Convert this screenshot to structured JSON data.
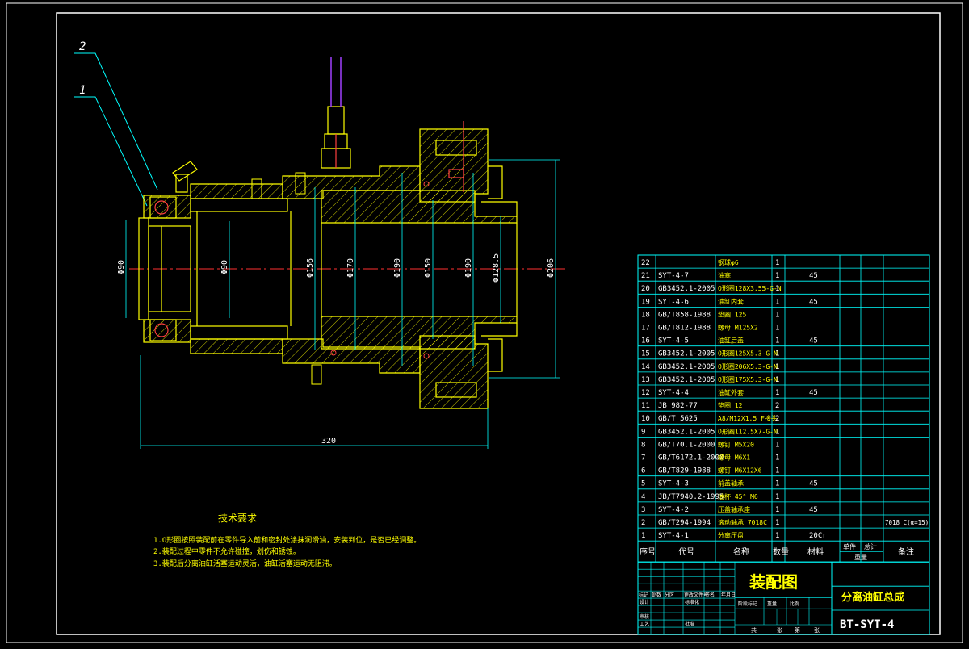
{
  "colors": {
    "background": "#000000",
    "frame": "#ffffff",
    "table_lines": "#00ffff",
    "table_text": "#ffffff",
    "section": "#ffff00",
    "hatch": "#ffff00",
    "centerline": "#ff3030",
    "dimension": "#00ffff",
    "leader": "#00ffff",
    "notes": "#ffff00",
    "rod": "#a040ff",
    "part_text_cjk": "#ffff00",
    "qty_text": "#ffffff",
    "title_drawing": "#ffff00",
    "title_code": "#ffffff"
  },
  "balloons": [
    "2",
    "1"
  ],
  "dimensions": {
    "length_320": "320",
    "d90_left": "Φ90",
    "d90_right": "Φ90",
    "d156": "Φ156",
    "d170": "Φ170",
    "d190a": "Φ190",
    "d150": "Φ150",
    "d190b": "Φ190",
    "d128_5": "Φ128.5",
    "d206": "Φ206"
  },
  "notes": {
    "title": "技术要求",
    "items": [
      "1.O形圈按照装配前在零件导入前和密封处涂抹润滑油，安装到位，是否已经调整。",
      "2.装配过程中零件不允许碰撞，划伤和锈蚀。",
      "3.装配后分离油缸活塞运动灵活，油缸活塞运动无阻滞。"
    ]
  },
  "bom": {
    "rows": [
      {
        "no": "22",
        "code": "",
        "name": "钢球φ6",
        "qty": "1",
        "material": "",
        "weight1": "",
        "note": ""
      },
      {
        "no": "21",
        "code": "SYT-4-7",
        "name": "油塞",
        "qty": "1",
        "material": "45",
        "weight1": "",
        "note": ""
      },
      {
        "no": "20",
        "code": "GB3452.1-2005",
        "name": "O形圈128X3.55-G-N",
        "qty": "1",
        "material": "",
        "weight1": "",
        "note": ""
      },
      {
        "no": "19",
        "code": "SYT-4-6",
        "name": "油缸内套",
        "qty": "1",
        "material": "45",
        "weight1": "",
        "note": ""
      },
      {
        "no": "18",
        "code": "GB/T858-1988",
        "name": "垫圈 125",
        "qty": "1",
        "material": "",
        "weight1": "",
        "note": ""
      },
      {
        "no": "17",
        "code": "GB/T812-1988",
        "name": "螺母 M125X2",
        "qty": "1",
        "material": "",
        "weight1": "",
        "note": ""
      },
      {
        "no": "16",
        "code": "SYT-4-5",
        "name": "油缸后盖",
        "qty": "1",
        "material": "45",
        "weight1": "",
        "note": ""
      },
      {
        "no": "15",
        "code": "GB3452.1-2005",
        "name": "O形圈125X5.3-G-N",
        "qty": "1",
        "material": "",
        "weight1": "",
        "note": ""
      },
      {
        "no": "14",
        "code": "GB3452.1-2005",
        "name": "O形圈206X5.3-G-N",
        "qty": "1",
        "material": "",
        "weight1": "",
        "note": ""
      },
      {
        "no": "13",
        "code": "GB3452.1-2005",
        "name": "O形圈175X5.3-G-N",
        "qty": "1",
        "material": "",
        "weight1": "",
        "note": ""
      },
      {
        "no": "12",
        "code": "SYT-4-4",
        "name": "油缸外套",
        "qty": "1",
        "material": "45",
        "weight1": "",
        "note": ""
      },
      {
        "no": "11",
        "code": "JB 982-77",
        "name": "垫圈 12",
        "qty": "2",
        "material": "",
        "weight1": "",
        "note": ""
      },
      {
        "no": "10",
        "code": "GB/T 5625",
        "name": "A8/M12X1.5 F接头",
        "qty": "2",
        "material": "",
        "weight1": "",
        "note": ""
      },
      {
        "no": "9",
        "code": "GB3452.1-2005",
        "name": "O形圈112.5X7-G-N",
        "qty": "1",
        "material": "",
        "weight1": "",
        "note": ""
      },
      {
        "no": "8",
        "code": "GB/T70.1-2000",
        "name": "螺钉 M5X20",
        "qty": "1",
        "material": "",
        "weight1": "",
        "note": ""
      },
      {
        "no": "7",
        "code": "GB/T6172.1-2000",
        "name": "螺母 M6X1",
        "qty": "1",
        "material": "",
        "weight1": "",
        "note": ""
      },
      {
        "no": "6",
        "code": "GB/T829-1988",
        "name": "螺钉 M6X12X6",
        "qty": "1",
        "material": "",
        "weight1": "",
        "note": ""
      },
      {
        "no": "5",
        "code": "SYT-4-3",
        "name": "前盖轴承",
        "qty": "1",
        "material": "45",
        "weight1": "",
        "note": ""
      },
      {
        "no": "4",
        "code": "JB/T7940.2-1995",
        "name": "油杯 45° M6",
        "qty": "1",
        "material": "",
        "weight1": "",
        "note": ""
      },
      {
        "no": "3",
        "code": "SYT-4-2",
        "name": "压盖轴承座",
        "qty": "1",
        "material": "45",
        "weight1": "",
        "note": ""
      },
      {
        "no": "2",
        "code": "GB/T294-1994",
        "name": "滚动轴承 7018C",
        "qty": "1",
        "material": "",
        "weight1": "",
        "note": "7018 C(α=15)"
      },
      {
        "no": "1",
        "code": "SYT-4-1",
        "name": "分离压盘",
        "qty": "1",
        "material": "20Cr",
        "weight1": "",
        "note": ""
      }
    ],
    "headers": {
      "no": "序号",
      "code": "代号",
      "name": "名称",
      "qty": "数量",
      "material": "材料",
      "single": "单件",
      "total": "总计",
      "weight": "重量",
      "note": "备注"
    }
  },
  "title_block": {
    "drawing_type": "装配图",
    "drawing_name": "分离油缸总成",
    "drawing_code": "BT-SYT-4",
    "labels_small": [
      "标记",
      "处数",
      "分区",
      "更改文件号",
      "签名",
      "年月日"
    ],
    "labels_row2": [
      "设计",
      "标准化"
    ],
    "labels_row3": [
      "审核"
    ],
    "labels_row4": [
      "工艺",
      "批准"
    ],
    "labels_stage": [
      "阶段标记",
      "重量",
      "比例"
    ],
    "labels_sheet": [
      "共",
      "张",
      "第",
      "张"
    ]
  }
}
